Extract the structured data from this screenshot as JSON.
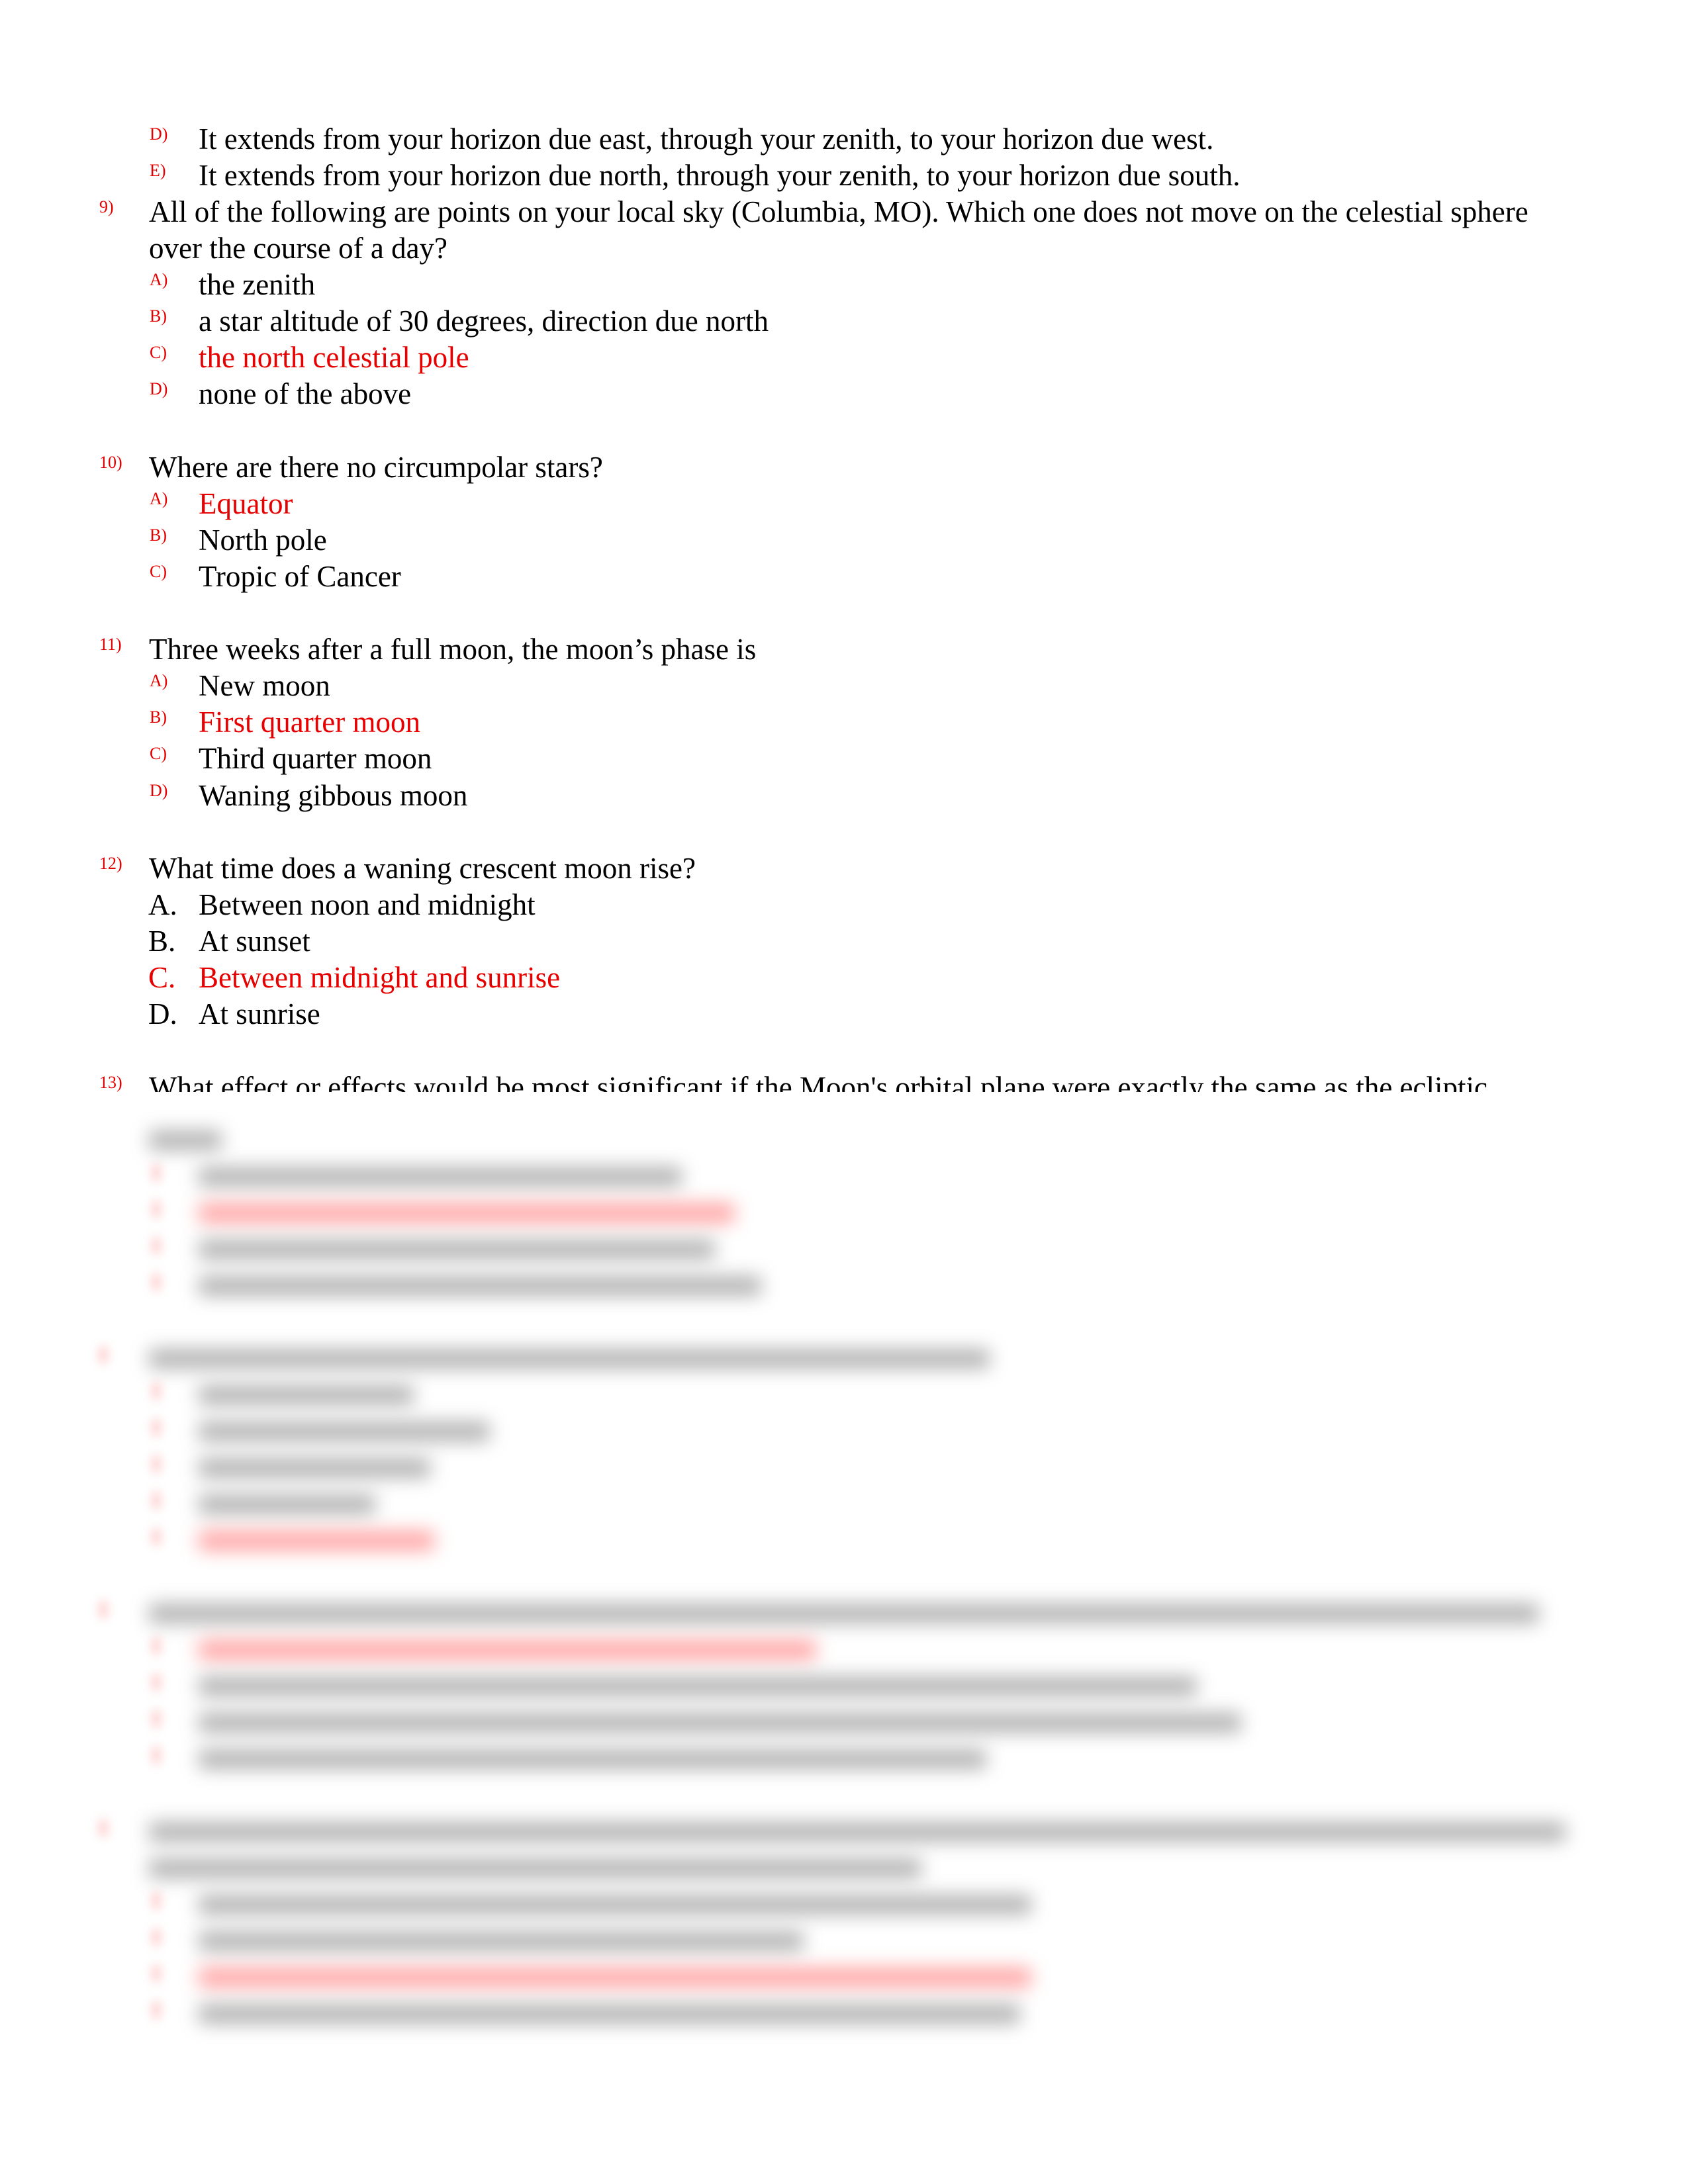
{
  "page": {
    "answer_color": "#e60000",
    "text_color": "#000000"
  },
  "continued_options": [
    {
      "label": "D)",
      "text": "It extends from your horizon due east, through your zenith, to your horizon due west.",
      "correct": false
    },
    {
      "label": "E)",
      "text": "It extends from your horizon due north, through your zenith, to your horizon due south.",
      "correct": false
    }
  ],
  "questions": [
    {
      "number": "9)",
      "lines": [
        "All of the following are points on your local sky (Columbia, MO).  Which one does not move on the celestial sphere",
        "over the course of a day?"
      ],
      "options": [
        {
          "label": "A)",
          "text": "the zenith",
          "correct": false
        },
        {
          "label": "B)",
          "text": "a star altitude of 30 degrees, direction due north",
          "correct": false
        },
        {
          "label": "C)",
          "text": "the north celestial pole",
          "correct": true
        },
        {
          "label": "D)",
          "text": "none of the above",
          "correct": false
        }
      ]
    },
    {
      "number": "10)",
      "lines": [
        "Where are there no circumpolar stars?"
      ],
      "options": [
        {
          "label": "A)",
          "text": "Equator",
          "correct": true
        },
        {
          "label": "B)",
          "text": "North pole",
          "correct": false
        },
        {
          "label": "C)",
          "text": "Tropic of Cancer",
          "correct": false
        }
      ]
    },
    {
      "number": "11)",
      "lines": [
        "Three weeks after a full moon, the moon’s phase is"
      ],
      "options": [
        {
          "label": "A)",
          "text": "New moon",
          "correct": false
        },
        {
          "label": "B)",
          "text": "First quarter moon",
          "correct": true
        },
        {
          "label": "C)",
          "text": "Third quarter moon",
          "correct": false
        },
        {
          "label": "D)",
          "text": "Waning gibbous moon",
          "correct": false
        }
      ]
    },
    {
      "number": "12)",
      "lines": [
        "What time does a waning crescent moon rise?"
      ],
      "options": [
        {
          "label": "A.",
          "text": "Between noon and midnight",
          "correct": false
        },
        {
          "label": "B.",
          "text": "At sunset",
          "correct": false
        },
        {
          "label": "C.",
          "text": "Between midnight and sunrise",
          "correct": true
        },
        {
          "label": "D.",
          "text": "At sunrise",
          "correct": false
        }
      ]
    },
    {
      "number": "13)",
      "lines": [
        "What effect or effects would be most significant if the Moon's orbital plane were exactly the same as the ecliptic"
      ],
      "truncated": true
    }
  ],
  "blurred_section": {
    "state": "blurred / not readable",
    "questions": [
      {
        "continuation_of": "13)",
        "question_lines": 1,
        "option_count": 4,
        "correct_option_index": 1
      },
      {
        "number_hidden": true,
        "question_lines": 1,
        "option_count": 5,
        "correct_option_index": 4
      },
      {
        "number_hidden": true,
        "question_lines": 1,
        "option_count": 4,
        "correct_option_index": 0
      },
      {
        "number_hidden": true,
        "question_lines": 2,
        "option_count": 4,
        "correct_option_index": 2
      }
    ]
  }
}
